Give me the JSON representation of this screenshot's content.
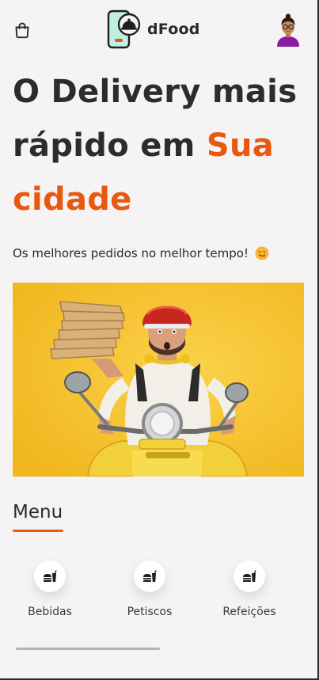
{
  "header": {
    "cart_icon": "shopping-bag-icon",
    "logo_icon": "phone-cloche-icon",
    "brand": "dFood",
    "avatar_icon": "user-avatar"
  },
  "hero": {
    "title_line1": "O Delivery mais",
    "title_line2_start": "rápido em ",
    "title_accent_1": "Sua",
    "title_accent_2": "cidade",
    "subtitle": "Os melhores pedidos no melhor tempo!",
    "subtitle_emoji": "yum-face-emoji",
    "image": "delivery-man-on-yellow-scooter-with-pizza-boxes"
  },
  "menu": {
    "title": "Menu",
    "categories": [
      {
        "label": "Bebidas",
        "icon": "food-drink-icon"
      },
      {
        "label": "Petiscos",
        "icon": "food-drink-icon"
      },
      {
        "label": "Refeições",
        "icon": "food-drink-icon"
      }
    ]
  },
  "colors": {
    "accent": "#e8580f",
    "background": "#f6f3f4",
    "text": "#2a2a2a",
    "banner_yellow": "#f5c232"
  }
}
